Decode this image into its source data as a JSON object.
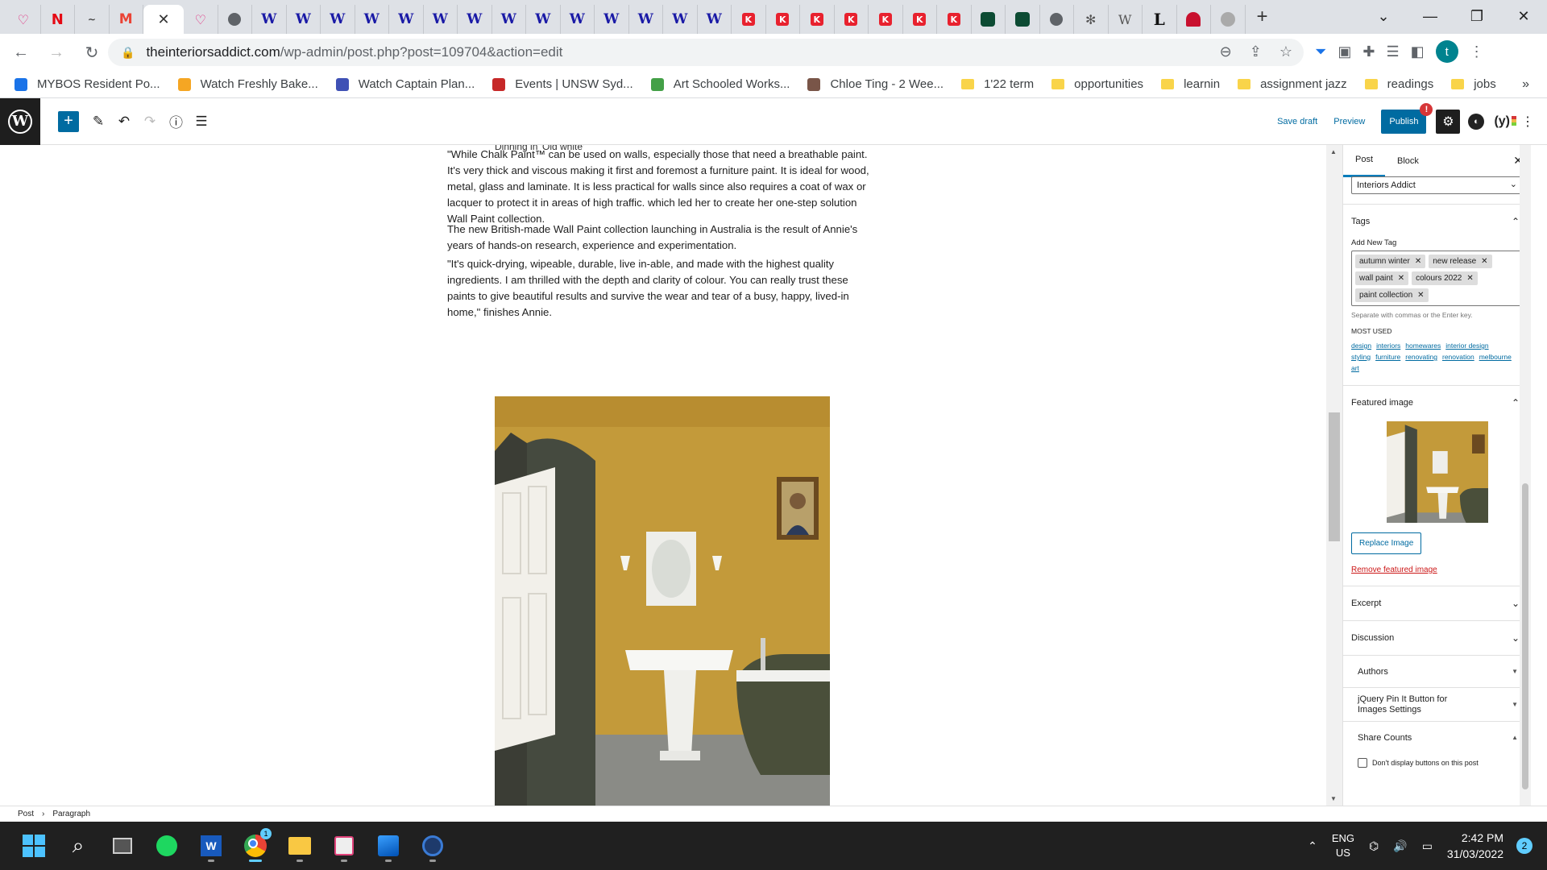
{
  "browser": {
    "tab_favicons": [
      "heart",
      "netflix",
      "signature",
      "gmail",
      "active",
      "heart",
      "globe",
      "w",
      "w",
      "w",
      "w",
      "w",
      "w",
      "w",
      "w",
      "w",
      "w",
      "w",
      "w",
      "w",
      "w",
      "kmart",
      "kmart",
      "kmart",
      "kmart",
      "kmart",
      "kmart",
      "kmart",
      "green",
      "green",
      "globe",
      "flower",
      "wiki",
      "L",
      "redbubble",
      "grey"
    ],
    "favicon_text": {
      "netflix": "N",
      "gmail": "M",
      "w": "W",
      "kmart": "K",
      "wiki": "W",
      "L": "L",
      "signature": "∼"
    },
    "close_glyph": "✕",
    "new_tab": "+",
    "window_controls": [
      "⌄",
      "—",
      "❐",
      "✕"
    ],
    "url_host": "theinteriorsaddict.com",
    "url_path": "/wp-admin/post.php?post=109704&action=edit",
    "avatar_letter": "t"
  },
  "bookmarks": [
    {
      "label": "MYBOS Resident Po...",
      "icon": "mybos",
      "color": "#1a73e8"
    },
    {
      "label": "Watch Freshly Bake...",
      "icon": "flower",
      "color": "#f5a623"
    },
    {
      "label": "Watch Captain Plan...",
      "icon": "captain",
      "color": "#3f51b5"
    },
    {
      "label": "Events | UNSW Syd...",
      "icon": "unsw",
      "color": "#c62828"
    },
    {
      "label": "Art Schooled Works...",
      "icon": "art",
      "color": "#43a047"
    },
    {
      "label": "Chloe Ting - 2 Wee...",
      "icon": "chloe",
      "color": "#795548"
    },
    {
      "label": "1'22 term",
      "icon": "folder"
    },
    {
      "label": "opportunities",
      "icon": "folder"
    },
    {
      "label": "learnin",
      "icon": "folder"
    },
    {
      "label": "assignment jazz",
      "icon": "folder"
    },
    {
      "label": "readings",
      "icon": "folder"
    },
    {
      "label": "jobs",
      "icon": "folder"
    }
  ],
  "bookmarks_more": "»",
  "wp_header": {
    "save_draft": "Save draft",
    "preview": "Preview",
    "publish": "Publish",
    "publish_badge": "!"
  },
  "content": {
    "caption": "Dinning in 'Old white'",
    "paragraphs": [
      "\"While Chalk Paint™ can be used on walls, especially those that need a breathable paint. It's very thick and viscous making it first and foremost a furniture paint. It is ideal for wood, metal, glass and laminate. It is less practical for walls since  also requires a coat of wax or lacquer to protect it in areas of high traffic. which led her to create her one-step solution Wall Paint collection.",
      "The new British-made Wall Paint collection launching in Australia is the result of Annie's years of hands-on research, experience and experimentation.",
      "\"It's quick-drying, wipeable, durable, live in-able, and made with the highest quality ingredients. I am thrilled with the depth and clarity of colour. You can really trust these paints to give beautiful results and survive the wear and tear of a busy, happy, lived-in home,\" finishes Annie."
    ]
  },
  "sidebar": {
    "tab_post": "Post",
    "tab_block": "Block",
    "author_select": "Interiors Addict",
    "tags_title": "Tags",
    "add_new_tag": "Add New Tag",
    "tags": [
      "autumn winter",
      "new release",
      "wall paint",
      "colours 2022",
      "paint collection"
    ],
    "tag_hint": "Separate with commas or the Enter key.",
    "most_used_title": "MOST USED",
    "most_used": [
      "design",
      "interiors",
      "homewares",
      "interior design",
      "styling",
      "furniture",
      "renovating",
      "renovation",
      "melbourne",
      "art"
    ],
    "featured_image_title": "Featured image",
    "replace_image": "Replace Image",
    "remove_featured": "Remove featured image",
    "excerpt": "Excerpt",
    "discussion": "Discussion",
    "authors": "Authors",
    "jquery_pin": "jQuery Pin It Button for Images Settings",
    "share_counts": "Share Counts",
    "dont_display": "Don't display buttons on this post"
  },
  "breadcrumb": [
    "Post",
    "Paragraph"
  ],
  "taskbar": {
    "lang_top": "ENG",
    "lang_bottom": "US",
    "time": "2:42 PM",
    "date": "31/03/2022",
    "notifications": "2",
    "chrome_badge": "1"
  },
  "colors": {
    "wp_blue": "#006ba1",
    "mustard_wall": "#c39a3a",
    "taskbar": "#202020"
  }
}
